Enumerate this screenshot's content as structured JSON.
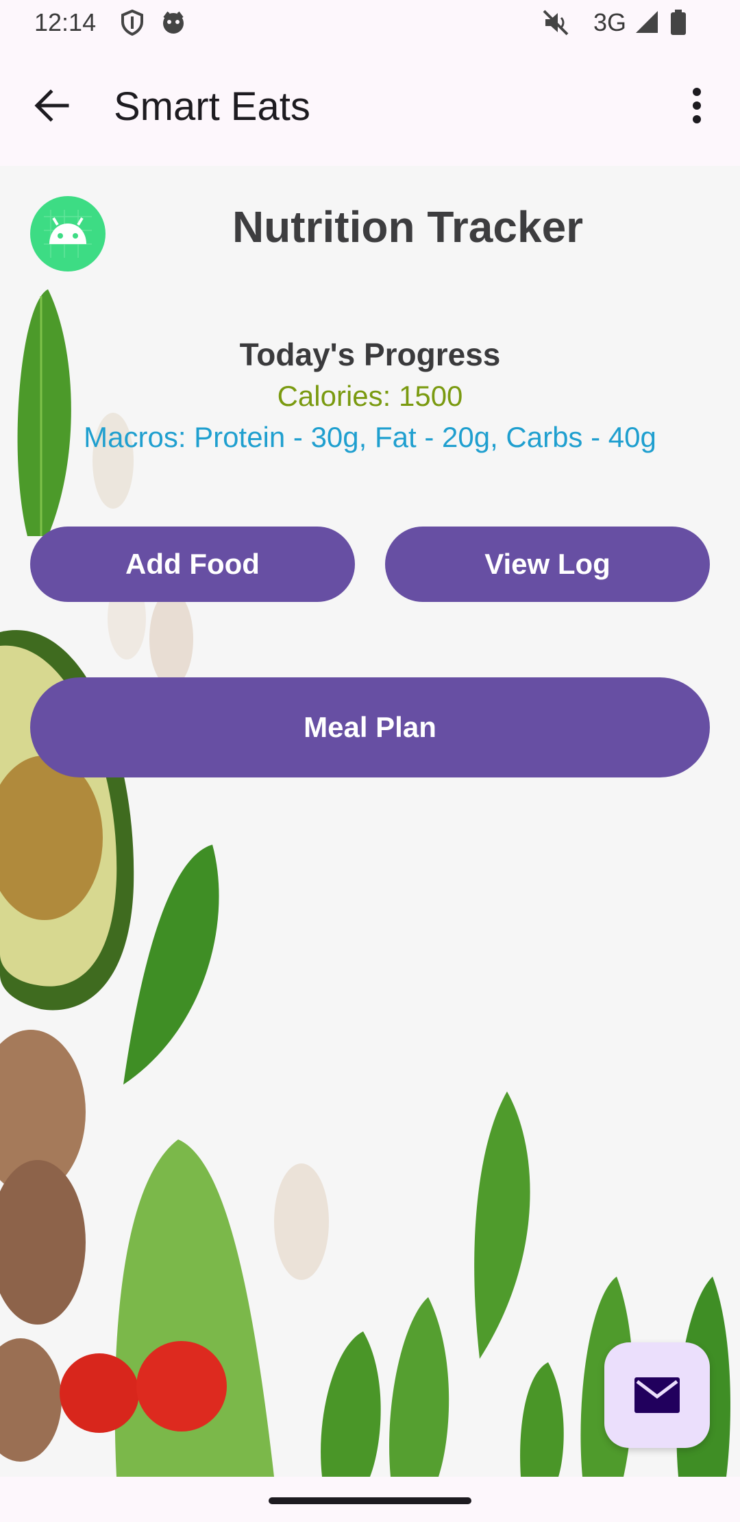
{
  "status_bar": {
    "time": "12:14",
    "network": "3G",
    "icons": [
      "shield-icon",
      "face-icon",
      "mute-icon",
      "signal-icon",
      "battery-icon"
    ]
  },
  "app_bar": {
    "title": "Smart Eats",
    "back_icon": "arrow-back-icon",
    "more_icon": "more-vert-icon"
  },
  "main": {
    "logo_icon": "android-logo-icon",
    "screen_title": "Nutrition Tracker",
    "progress": {
      "title": "Today's Progress",
      "calories": "Calories: 1500",
      "macros": "Macros: Protein - 30g, Fat - 20g, Carbs - 40g"
    },
    "buttons": {
      "add_food": "Add Food",
      "view_log": "View Log",
      "meal_plan": "Meal Plan"
    },
    "fab_icon": "mail-icon"
  },
  "colors": {
    "primary": "#674fa3",
    "calories": "#7a9a10",
    "macros": "#1f9fcf",
    "fab": "#ebdffc",
    "logo": "#3ddc84"
  }
}
